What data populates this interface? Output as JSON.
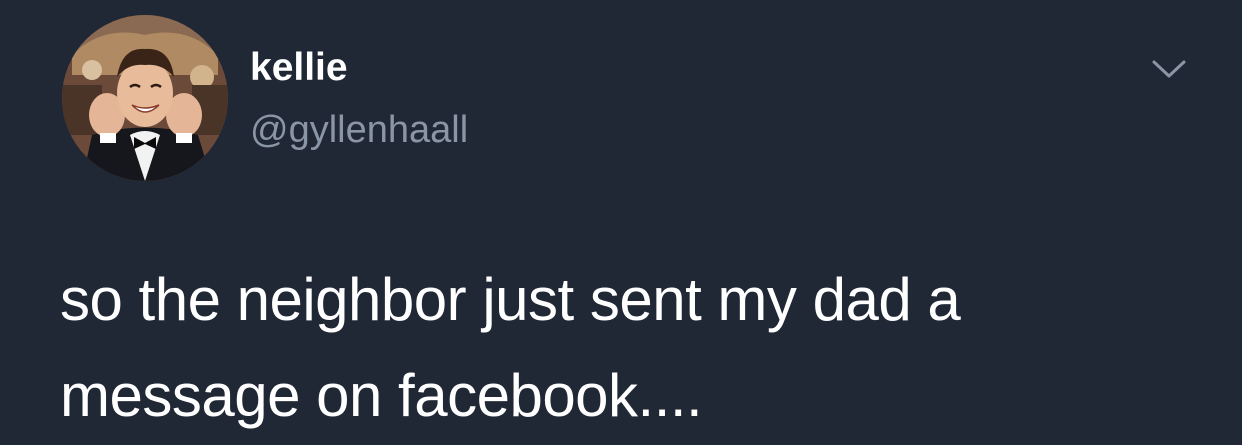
{
  "tweet": {
    "display_name": "kellie",
    "handle": "@gyllenhaall",
    "text": "so the neighbor just sent my dad a message on facebook....",
    "avatar_icon": "profile-avatar",
    "menu_icon": "chevron-down-icon"
  },
  "colors": {
    "background": "#202835",
    "primary_text": "#ffffff",
    "secondary_text": "#8a96a5"
  }
}
